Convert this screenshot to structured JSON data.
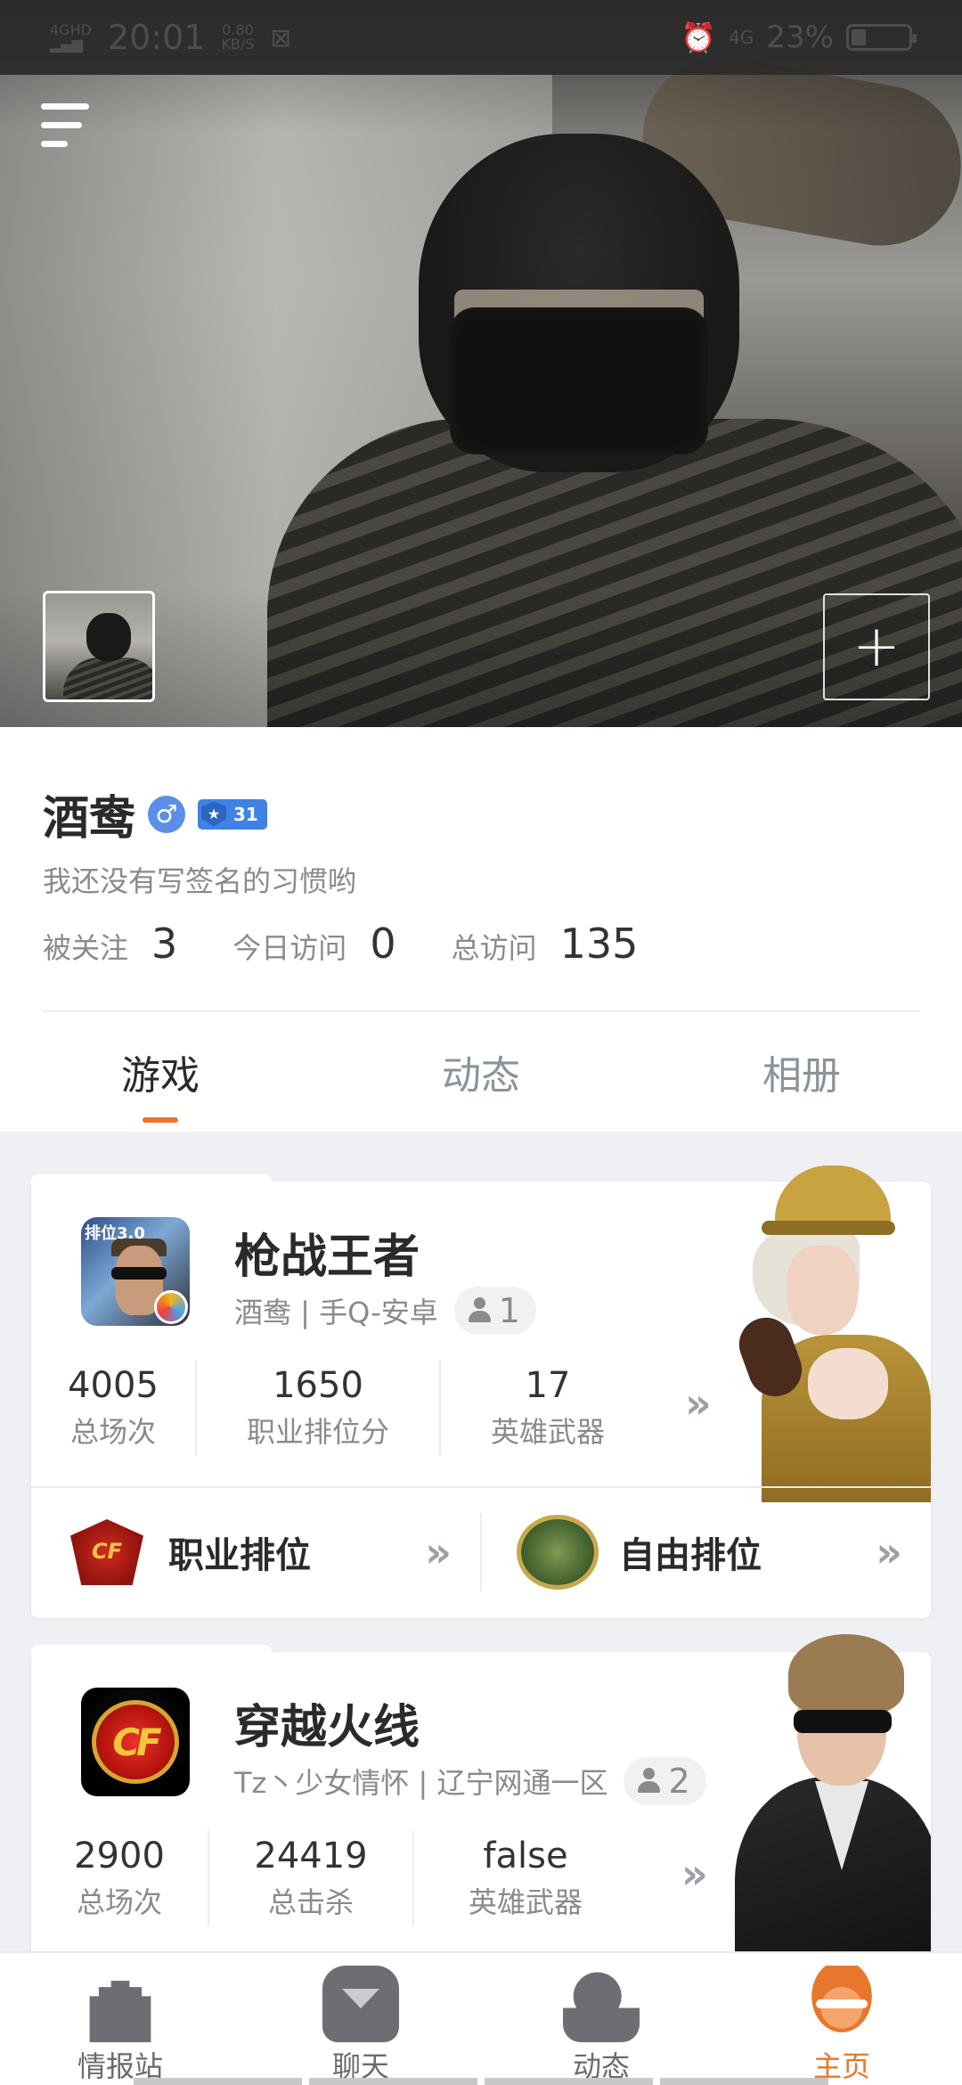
{
  "status_bar": {
    "signal_text": "4GHD",
    "time": "20:01",
    "speed_value": "0.80",
    "speed_unit": "KB/S",
    "network": "4G",
    "battery": "23%",
    "battery_level": 0.23
  },
  "profile": {
    "name": "酒鸯",
    "gender_symbol": "♂",
    "level": "31",
    "signature": "我还没有写签名的习惯哟",
    "stats": [
      {
        "label": "被关注",
        "value": "3"
      },
      {
        "label": "今日访问",
        "value": "0"
      },
      {
        "label": "总访问",
        "value": "135"
      }
    ],
    "add_symbol": "+"
  },
  "tabs": [
    {
      "label": "游戏",
      "active": true
    },
    {
      "label": "动态",
      "active": false
    },
    {
      "label": "相册",
      "active": false
    }
  ],
  "games": [
    {
      "title": "枪战王者",
      "icon_text": "排位3.0",
      "subtitle": "酒鸯 | 手Q-安卓",
      "friends": "1",
      "stats": [
        {
          "value": "4005",
          "label": "总场次"
        },
        {
          "value": "1650",
          "label": "职业排位分"
        },
        {
          "value": "17",
          "label": "英雄武器"
        }
      ],
      "ranks": [
        {
          "label": "职业排位"
        },
        {
          "label": "自由排位"
        }
      ]
    },
    {
      "title": "穿越火线",
      "icon_text": "CF",
      "subtitle": "Tz丶少女情怀 | 辽宁网通一区",
      "friends": "2",
      "stats": [
        {
          "value": "2900",
          "label": "总场次"
        },
        {
          "value": "24419",
          "label": "总击杀"
        },
        {
          "value": "false",
          "label": "英雄武器"
        }
      ]
    }
  ],
  "more_symbol": "»",
  "bottom_nav": [
    {
      "label": "情报站",
      "icon": "castle-icon",
      "active": false
    },
    {
      "label": "聊天",
      "icon": "robot-icon",
      "active": false
    },
    {
      "label": "动态",
      "icon": "soldier-icon",
      "active": false
    },
    {
      "label": "主页",
      "icon": "helmet-icon",
      "active": true
    }
  ],
  "colors": {
    "accent": "#e8772e",
    "level_badge": "#3f82e3",
    "gender": "#5b8ee6"
  }
}
